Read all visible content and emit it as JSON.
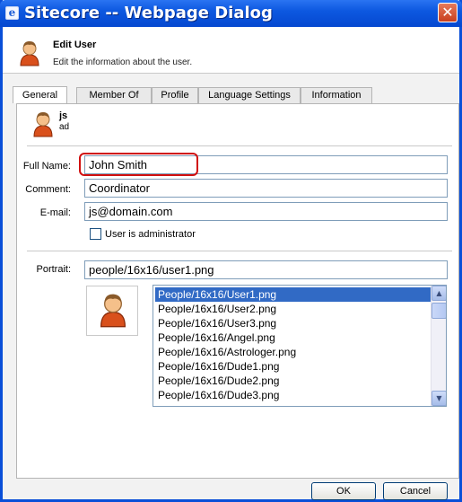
{
  "window": {
    "title": "Sitecore -- Webpage Dialog",
    "close_glyph": "✕",
    "app_glyph": "e"
  },
  "header": {
    "title": "Edit User",
    "subtitle": "Edit the information about the user.",
    "icon": "user-icon"
  },
  "tabs": [
    {
      "label": "General",
      "active": true
    },
    {
      "label": "Member Of",
      "active": false
    },
    {
      "label": "Profile",
      "active": false
    },
    {
      "label": "Language Settings",
      "active": false
    },
    {
      "label": "Information",
      "active": false
    }
  ],
  "user": {
    "name": "js",
    "id": "ad"
  },
  "form": {
    "full_name_label": "Full Name:",
    "full_name_value": "John Smith",
    "comment_label": "Comment:",
    "comment_value": "Coordinator",
    "email_label": "E-mail:",
    "email_value": "js@domain.com",
    "admin_label": "User is administrator",
    "admin_checked": false,
    "portrait_label": "Portrait:",
    "portrait_value": "people/16x16/user1.png"
  },
  "portrait_list": {
    "items": [
      "People/16x16/User1.png",
      "People/16x16/User2.png",
      "People/16x16/User3.png",
      "People/16x16/Angel.png",
      "People/16x16/Astrologer.png",
      "People/16x16/Dude1.png",
      "People/16x16/Dude2.png",
      "People/16x16/Dude3.png"
    ],
    "selected_index": 0
  },
  "buttons": {
    "ok": "OK",
    "cancel": "Cancel"
  },
  "colors": {
    "titlebar": "#0d58e0",
    "selection": "#316ac5",
    "highlight_ring": "#d01010"
  }
}
